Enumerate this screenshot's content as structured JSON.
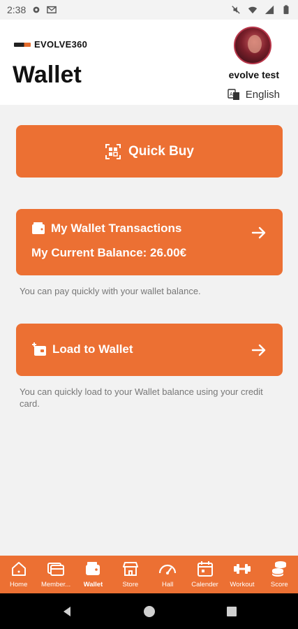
{
  "status_bar": {
    "time": "2:38",
    "icons": [
      "gear-icon",
      "gmail-icon",
      "mute-icon",
      "wifi-icon",
      "signal-icon",
      "battery-icon"
    ]
  },
  "header": {
    "brand_name": "EVOLVE360",
    "title": "Wallet",
    "user_name": "evolve test",
    "language": "English"
  },
  "quick_buy": {
    "label": "Quick Buy"
  },
  "wallet_card": {
    "title": "My Wallet Transactions",
    "balance_text": "My Current Balance: 26.00€",
    "hint": "You can pay quickly with your wallet balance."
  },
  "load_card": {
    "title": "Load to Wallet",
    "hint": "You can quickly load to your Wallet balance using your credit card."
  },
  "bottom_nav": {
    "items": [
      {
        "label": "Home",
        "icon": "home-icon"
      },
      {
        "label": "Member...",
        "icon": "membership-icon"
      },
      {
        "label": "Wallet",
        "icon": "wallet-icon",
        "active": true
      },
      {
        "label": "Store",
        "icon": "store-icon"
      },
      {
        "label": "Hall",
        "icon": "gauge-icon"
      },
      {
        "label": "Calender",
        "icon": "calendar-icon"
      },
      {
        "label": "Workout",
        "icon": "dumbbell-icon"
      },
      {
        "label": "Score",
        "icon": "coins-icon"
      }
    ]
  },
  "colors": {
    "accent": "#ec7033",
    "background": "#f2f2f2",
    "header_bg": "#ffffff"
  }
}
